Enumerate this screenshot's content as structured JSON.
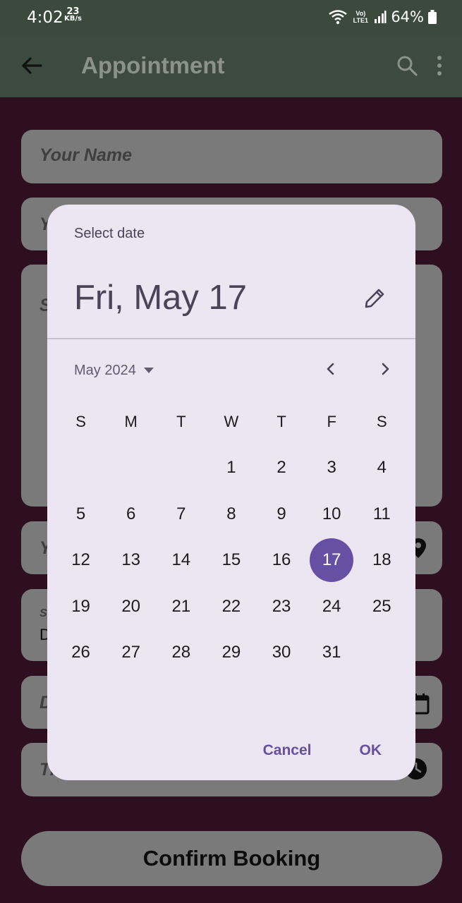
{
  "status_bar": {
    "time": "4:02",
    "speed_value": "23",
    "speed_unit": "KB/s",
    "network": "Vo) LTE1",
    "battery": "64%"
  },
  "app_bar": {
    "title": "Appointment"
  },
  "form": {
    "name_placeholder": "Your Name",
    "phone_placeholder_partial": "Y",
    "notes_placeholder_partial": "S",
    "location_placeholder_partial": "Y",
    "service_label_partial": "S",
    "service_value_partial": "D",
    "date_placeholder_partial": "D",
    "time_placeholder_partial": "Ti",
    "confirm_label": "Confirm Booking"
  },
  "date_picker": {
    "label": "Select date",
    "headline": "Fri, May 17",
    "month_label": "May 2024",
    "weekdays": [
      "S",
      "M",
      "T",
      "W",
      "T",
      "F",
      "S"
    ],
    "weeks": [
      [
        "",
        "",
        "",
        "1",
        "2",
        "3",
        "4"
      ],
      [
        "5",
        "6",
        "7",
        "8",
        "9",
        "10",
        "11"
      ],
      [
        "12",
        "13",
        "14",
        "15",
        "16",
        "17",
        "18"
      ],
      [
        "19",
        "20",
        "21",
        "22",
        "23",
        "24",
        "25"
      ],
      [
        "26",
        "27",
        "28",
        "29",
        "30",
        "31",
        ""
      ]
    ],
    "selected_day": "17",
    "cancel_label": "Cancel",
    "ok_label": "OK"
  },
  "colors": {
    "status_bar": "#3b4a3d",
    "app_bar": "#3d4a3f",
    "background": "#2e0f20",
    "field": "#7a7a7a",
    "dialog": "#ece6f3",
    "accent": "#6750a4"
  },
  "icons": {
    "back": "arrow-left-icon",
    "search": "search-icon",
    "more": "more-vert-icon",
    "edit": "pencil-icon",
    "dropdown": "triangle-down-icon",
    "prev": "chevron-left-icon",
    "next": "chevron-right-icon",
    "location": "location-pin-icon",
    "calendar": "calendar-icon",
    "clock": "clock-icon"
  }
}
